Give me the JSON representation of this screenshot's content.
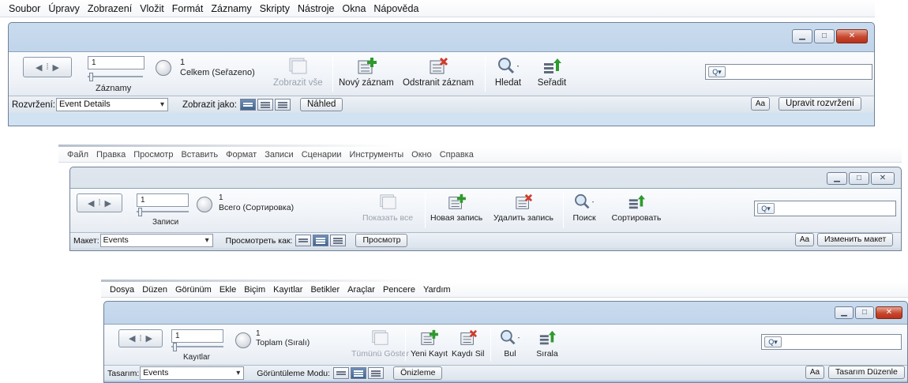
{
  "windows": [
    {
      "lang": "cs",
      "menu": [
        "Soubor",
        "Úpravy",
        "Zobrazení",
        "Vložit",
        "Formát",
        "Záznamy",
        "Skripty",
        "Nástroje",
        "Okna",
        "Nápověda"
      ],
      "record_number": "1",
      "records_label": "Záznamy",
      "count_number": "1",
      "count_text": "Celkem (Seřazeno)",
      "show_all": "Zobrazit vše",
      "new_record": "Nový záznam",
      "delete_record": "Odstranit záznam",
      "find": "Hledat",
      "sort": "Seřadit",
      "layout_label": "Rozvržení:",
      "layout_value": "Event Details",
      "view_as": "Zobrazit jako:",
      "preview": "Náhled",
      "aa": "Aa",
      "edit_layout": "Upravit rozvržení"
    },
    {
      "lang": "ru",
      "menu": [
        "Файл",
        "Правка",
        "Просмотр",
        "Вставить",
        "Формат",
        "Записи",
        "Сценарии",
        "Инструменты",
        "Окно",
        "Справка"
      ],
      "record_number": "1",
      "records_label": "Записи",
      "count_number": "1",
      "count_text": "Всего (Сортировка)",
      "show_all": "Показать все",
      "new_record": "Новая запись",
      "delete_record": "Удалить запись",
      "find": "Поиск",
      "sort": "Сортировать",
      "layout_label": "Макет:",
      "layout_value": "Events",
      "view_as": "Просмотреть как:",
      "preview": "Просмотр",
      "aa": "Aa",
      "edit_layout": "Изменить макет"
    },
    {
      "lang": "tr",
      "menu": [
        "Dosya",
        "Düzen",
        "Görünüm",
        "Ekle",
        "Biçim",
        "Kayıtlar",
        "Betikler",
        "Araçlar",
        "Pencere",
        "Yardım"
      ],
      "record_number": "1",
      "records_label": "Kayıtlar",
      "count_number": "1",
      "count_text": "Toplam (Sıralı)",
      "show_all": "Tümünü Göster",
      "new_record": "Yeni Kayıt",
      "delete_record": "Kaydı Sil",
      "find": "Bul",
      "sort": "Sırala",
      "layout_label": "Tasarım:",
      "layout_value": "Events",
      "view_as": "Görüntüleme Modu:",
      "preview": "Önizleme",
      "aa": "Aa",
      "edit_layout": "Tasarım Düzenle"
    }
  ],
  "icons": {
    "search": "magnifier-icon",
    "new": "new-record-icon",
    "delete": "delete-record-icon",
    "sort": "sort-icon",
    "show_all": "show-all-icon"
  },
  "colors": {
    "frame": "#b7cde6",
    "content": "#d1e2f3",
    "close_red": "#c7472f",
    "new_green": "#2e9a2e",
    "delete_red": "#d23a2a"
  }
}
